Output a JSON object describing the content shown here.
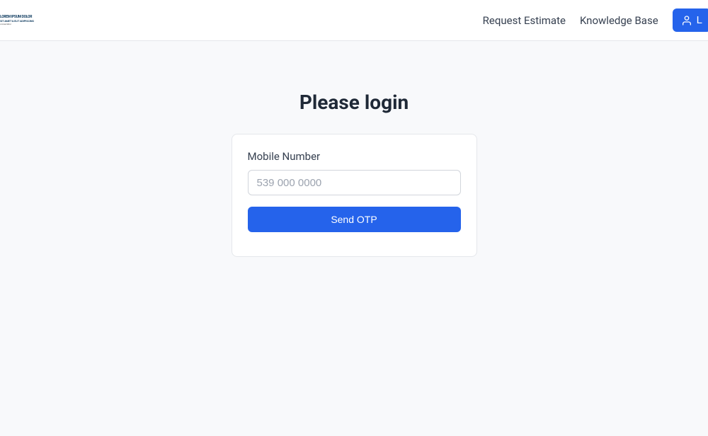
{
  "header": {
    "nav": {
      "request_estimate": "Request Estimate",
      "knowledge_base": "Knowledge Base"
    },
    "login_button": "L"
  },
  "main": {
    "title": "Please login",
    "form": {
      "mobile_label": "Mobile Number",
      "mobile_placeholder": "539 000 0000",
      "submit_label": "Send OTP"
    }
  }
}
